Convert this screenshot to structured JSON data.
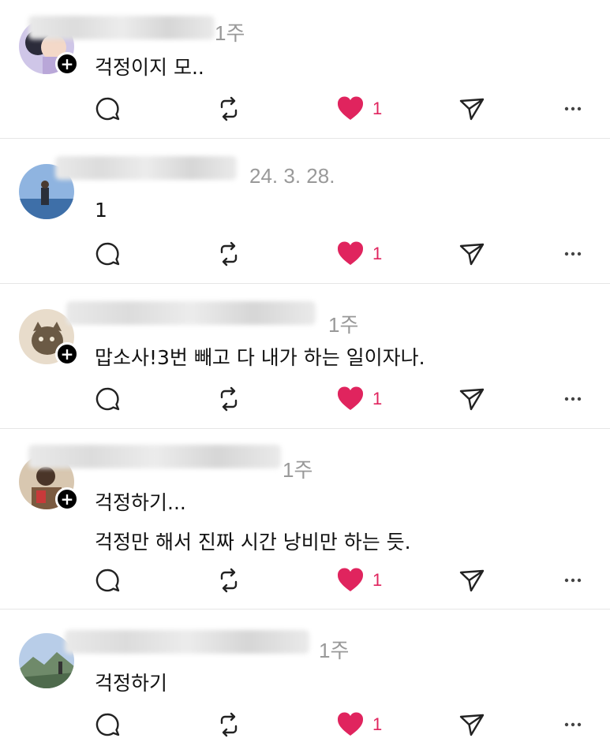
{
  "posts": [
    {
      "time": "1주",
      "text": "걱정이지 모..",
      "likes": "1",
      "follow": "+"
    },
    {
      "time": "24. 3. 28.",
      "text": "1",
      "likes": "1"
    },
    {
      "time": "1주",
      "text": "맙소사!3번 빼고 다 내가 하는 일이자나.",
      "likes": "1",
      "follow": "+"
    },
    {
      "time": "1주",
      "text": "걱정하기...",
      "text2": "걱정만 해서 진짜 시간 낭비만 하는 듯.",
      "likes": "1",
      "follow": "+"
    },
    {
      "time": "1주",
      "text": "걱정하기",
      "likes": "1"
    }
  ],
  "colors": {
    "like": "#e0245e",
    "icon": "#222222",
    "muted": "#999999"
  },
  "icons": [
    "comment-icon",
    "repost-icon",
    "heart-icon",
    "send-icon",
    "more-icon"
  ]
}
